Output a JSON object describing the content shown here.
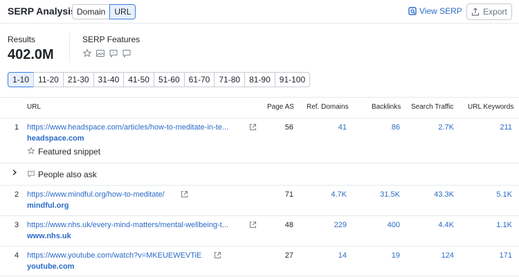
{
  "header": {
    "title": "SERP Analysis",
    "segments": [
      "Domain",
      "URL"
    ],
    "view_serp": "View SERP",
    "export": "Export"
  },
  "stats": {
    "results_label": "Results",
    "results_value": "402.0M",
    "features_label": "SERP Features",
    "feature_icons": [
      "featured-snippet-icon",
      "image-pack-icon",
      "people-also-ask-icon",
      "reviews-icon"
    ]
  },
  "pagination": [
    "1-10",
    "11-20",
    "21-30",
    "31-40",
    "41-50",
    "51-60",
    "61-70",
    "71-80",
    "81-90",
    "91-100"
  ],
  "table": {
    "columns": [
      "URL",
      "Page AS",
      "Ref. Domains",
      "Backlinks",
      "Search Traffic",
      "URL Keywords"
    ],
    "rows": [
      {
        "index": "1",
        "url": "https://www.headspace.com/articles/how-to-meditate-in-te...",
        "domain": "headspace.com",
        "extra": "Featured snippet",
        "page_as": "56",
        "ref_domains": "41",
        "backlinks": "86",
        "search_traffic": "2.7K",
        "url_keywords": "211"
      },
      {
        "expandable_label": "People also ask"
      },
      {
        "index": "2",
        "url": "https://www.mindful.org/how-to-meditate/",
        "domain": "mindful.org",
        "page_as": "71",
        "ref_domains": "4.7K",
        "backlinks": "31.5K",
        "search_traffic": "43.3K",
        "url_keywords": "5.1K"
      },
      {
        "index": "3",
        "url": "https://www.nhs.uk/every-mind-matters/mental-wellbeing-t...",
        "domain": "www.nhs.uk",
        "page_as": "48",
        "ref_domains": "229",
        "backlinks": "400",
        "search_traffic": "4.4K",
        "url_keywords": "1.1K"
      },
      {
        "index": "4",
        "url": "https://www.youtube.com/watch?v=MKEUEWEVTiE",
        "domain": "youtube.com",
        "page_as": "27",
        "ref_domains": "14",
        "backlinks": "19",
        "search_traffic": "124",
        "url_keywords": "171"
      }
    ]
  },
  "colors": {
    "link": "#2a6bc7",
    "active_bg": "#e8f0fc",
    "border": "#c6cbd3"
  }
}
